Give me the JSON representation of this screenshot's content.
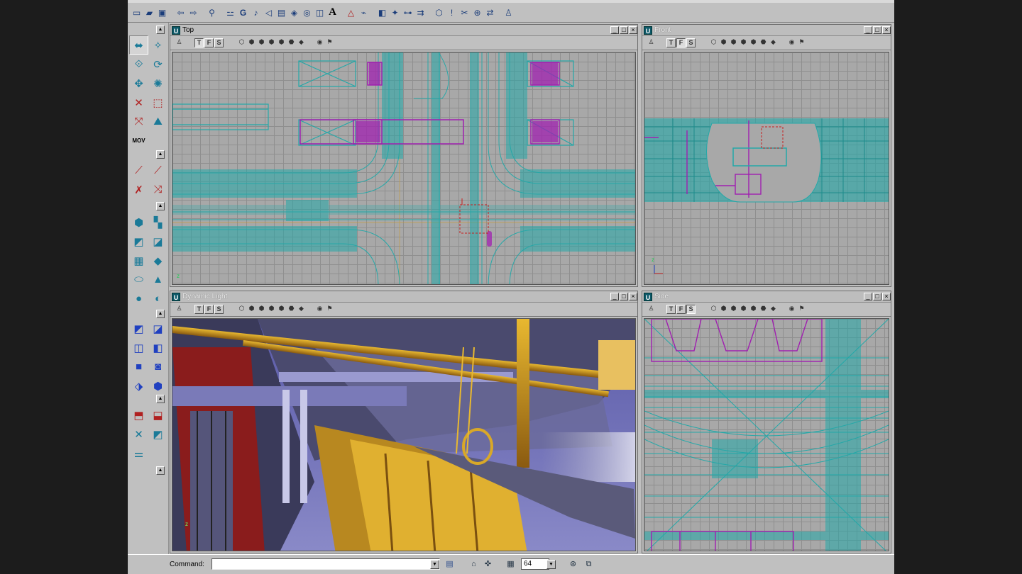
{
  "toolbar_icons": [
    "new-icon",
    "open-icon",
    "save-icon",
    "undo-icon",
    "redo-icon",
    "binoculars-icon",
    "actor-class-icon",
    "group-browser-icon",
    "music-icon",
    "sound-icon",
    "texture-icon",
    "mesh-icon",
    "prefab-icon",
    "static-mesh-icon",
    "font-icon",
    "terrain-icon",
    "animation-icon",
    "build-geometry-icon",
    "build-lighting-icon",
    "build-paths-icon",
    "build-all-icon",
    "rebuild-icon",
    "play-icon",
    "kismet-icon",
    "matinee-icon",
    "properties-icon"
  ],
  "viewports": [
    {
      "name": "Top",
      "modes": [
        "T",
        "F",
        "S"
      ],
      "active_mode": "T"
    },
    {
      "name": "Front",
      "modes": [
        "T",
        "F",
        "S"
      ],
      "active_mode": "F"
    },
    {
      "name": "Dynamic Light",
      "modes": [
        "T",
        "F",
        "S"
      ],
      "active_mode": ""
    },
    {
      "name": "Side",
      "modes": [
        "T",
        "F",
        "S"
      ],
      "active_mode": "S"
    }
  ],
  "window_buttons": {
    "minimize": "_",
    "maximize": "□",
    "close": "×"
  },
  "status_bar": {
    "command_label": "Command:",
    "command_value": "",
    "grid_size": "64"
  },
  "colors": {
    "wire": "#23a8a8",
    "brush": "#b020b8",
    "selected": "#c81e1e",
    "app_bg": "#c0c0c0"
  }
}
